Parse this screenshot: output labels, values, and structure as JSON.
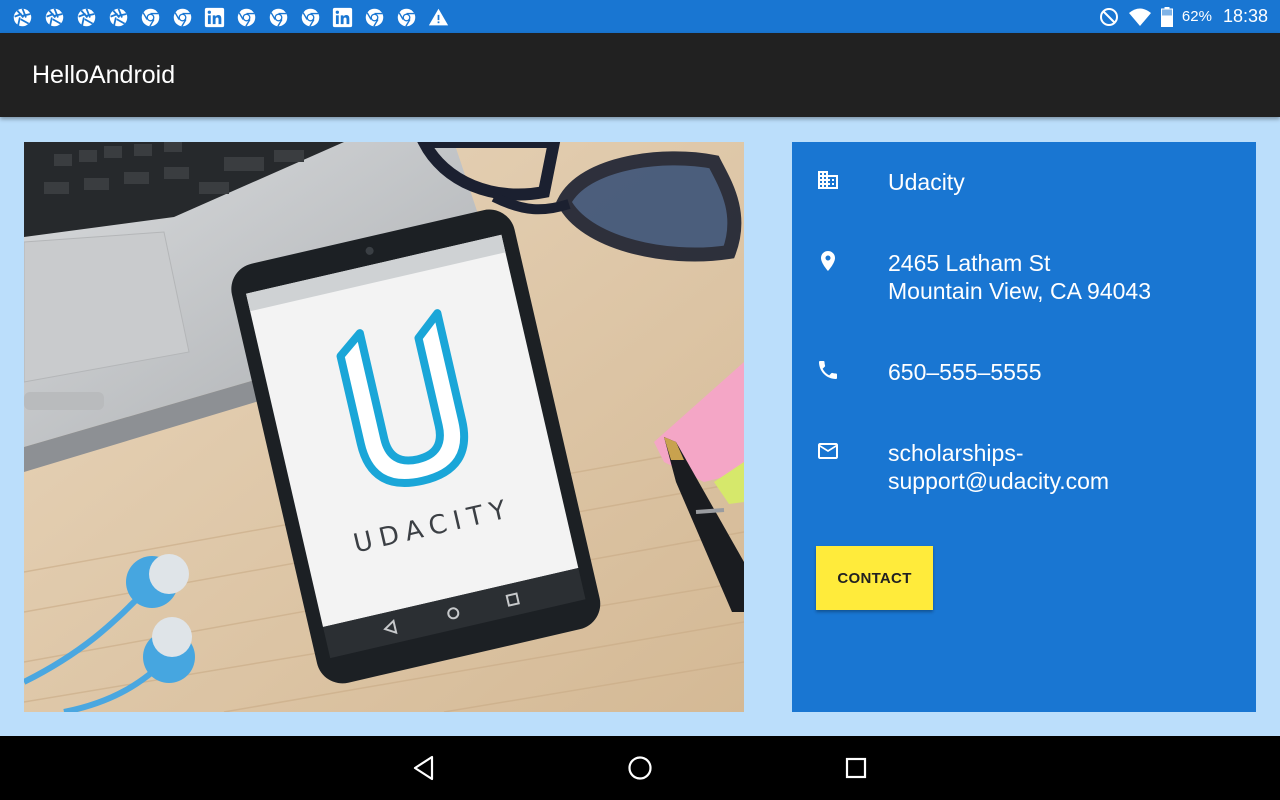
{
  "status_bar": {
    "notification_icons": [
      "aperture-icon",
      "aperture-icon",
      "aperture-icon",
      "aperture-icon",
      "chrome-icon",
      "chrome-icon",
      "linkedin-icon",
      "chrome-icon",
      "chrome-icon",
      "chrome-icon",
      "linkedin-icon",
      "chrome-icon",
      "chrome-icon",
      "warning-icon"
    ],
    "battery_percent": "62%",
    "time": "18:38"
  },
  "app_bar": {
    "title": "HelloAndroid"
  },
  "photo": {
    "phone_logo_text": "UDACITY"
  },
  "card": {
    "company": "Udacity",
    "address_line1": "2465 Latham St",
    "address_line2": "Mountain View, CA 94043",
    "phone": "650–555–5555",
    "email_line1": "scholarships-",
    "email_line2": "support@udacity.com",
    "contact_label": "CONTACT"
  },
  "colors": {
    "status_bar": "#1976d2",
    "app_bar": "#212121",
    "background": "#bbdefb",
    "card": "#1976d2",
    "button": "#ffeb3b"
  }
}
